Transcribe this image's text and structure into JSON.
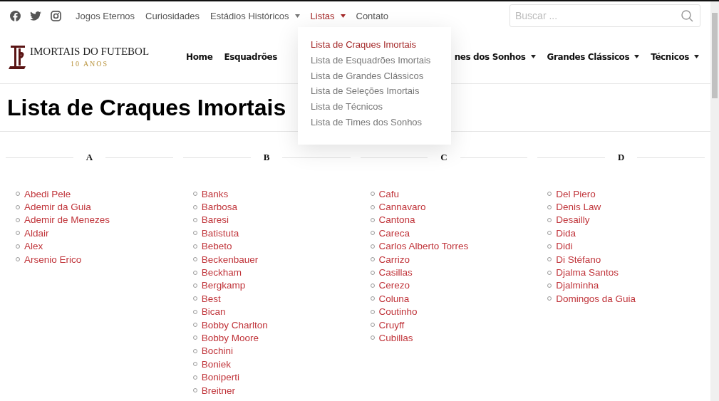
{
  "top_nav": [
    {
      "label": "Jogos Eternos",
      "dropdown": false,
      "selected": false
    },
    {
      "label": "Curiosidades",
      "dropdown": false,
      "selected": false
    },
    {
      "label": "Estádios Históricos",
      "dropdown": true,
      "selected": false
    },
    {
      "label": "Listas",
      "dropdown": true,
      "selected": true
    },
    {
      "label": "Contato",
      "dropdown": false,
      "selected": false
    }
  ],
  "search": {
    "placeholder": "Buscar ..."
  },
  "logo": {
    "title": "IMORTAIS DO FUTEBOL",
    "subtitle": "10 ANOS"
  },
  "main_nav": [
    {
      "label": "Home",
      "dropdown": false
    },
    {
      "label": "Esquadrões",
      "dropdown": false
    },
    {
      "label": "nes dos Sonhos",
      "dropdown": true
    },
    {
      "label": "Grandes Clássicos",
      "dropdown": true
    },
    {
      "label": "Técnicos",
      "dropdown": true
    }
  ],
  "dropdown": [
    {
      "label": "Lista de Craques Imortais",
      "selected": true
    },
    {
      "label": "Lista de Esquadrões Imortais",
      "selected": false
    },
    {
      "label": "Lista de Grandes Clássicos",
      "selected": false
    },
    {
      "label": "Lista de Seleções Imortais",
      "selected": false
    },
    {
      "label": "Lista de Técnicos",
      "selected": false
    },
    {
      "label": "Lista de Times dos Sonhos",
      "selected": false
    }
  ],
  "page_title": "Lista de Craques Imortais",
  "columns": [
    {
      "letter": "A",
      "players": [
        "Abedi Pele",
        "Ademir da Guia",
        "Ademir de Menezes",
        "Aldair",
        "Alex",
        "Arsenio Erico"
      ]
    },
    {
      "letter": "B",
      "players": [
        "Banks",
        "Barbosa",
        "Baresi",
        "Batistuta",
        "Bebeto",
        "Beckenbauer",
        "Beckham",
        "Bergkamp",
        "Best",
        "Bican",
        "Bobby Charlton",
        "Bobby Moore",
        "Bochini",
        "Boniek",
        "Boniperti",
        "Breitner"
      ]
    },
    {
      "letter": "C",
      "players": [
        "Cafu",
        "Cannavaro",
        "Cantona",
        "Careca",
        "Carlos Alberto Torres",
        "Carrizo",
        "Casillas",
        "Cerezo",
        "Coluna",
        "Coutinho",
        "Cruyff",
        "Cubillas"
      ]
    },
    {
      "letter": "D",
      "players": [
        "Del Piero",
        "Denis Law",
        "Desailly",
        "Dida",
        "Didi",
        "Di Stéfano",
        "Djalma Santos",
        "Djalminha",
        "Domingos da Guia"
      ]
    }
  ]
}
